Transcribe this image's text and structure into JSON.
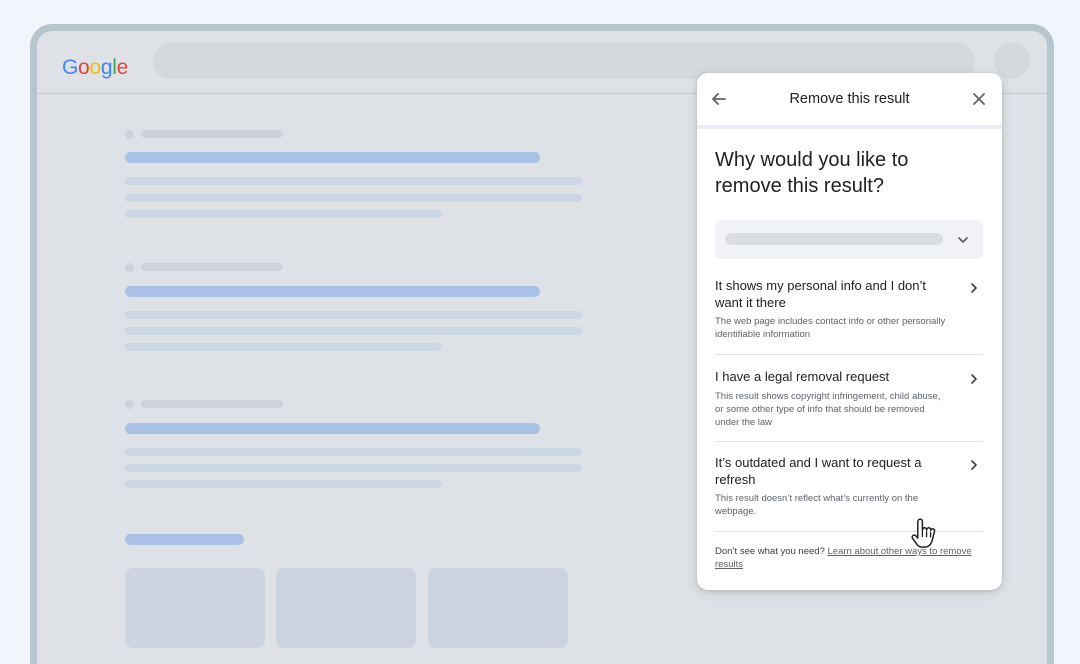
{
  "browser": {
    "logo": {
      "text": "Google",
      "letters": [
        "G",
        "o",
        "o",
        "g",
        "l",
        "e"
      ]
    }
  },
  "dialog": {
    "title": "Remove this result",
    "question": "Why would you like to remove this result?",
    "options": [
      {
        "title": "It shows my personal info and I don’t want it there",
        "description": "The web page includes contact info or other personally identifiable information"
      },
      {
        "title": "I have a legal removal request",
        "description": "This result shows copyright infringement, child abuse, or some other type of info that should be removed under the law"
      },
      {
        "title": "It’s outdated and I want to request a refresh",
        "description": "This result doesn’t reflect what’s currently on the webpage."
      }
    ],
    "footer": {
      "text": "Don’t see what you need?",
      "link": "Learn about other ways to remove results"
    }
  },
  "icons": {
    "back": "arrow-left-icon",
    "close": "close-icon",
    "dropdown": "chevron-down-icon",
    "option_arrow": "chevron-right-icon",
    "cursor": "hand-pointer-icon"
  },
  "colors": {
    "google_blue": "#4285f4",
    "google_red": "#ea4335",
    "google_yellow": "#fbbc05",
    "google_green": "#34a853",
    "placeholder_title": "#a9c1e4",
    "dialog_bg": "#ffffff"
  }
}
